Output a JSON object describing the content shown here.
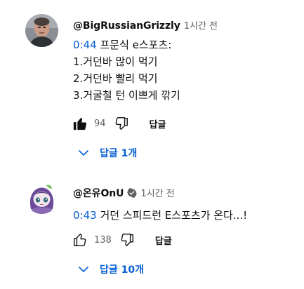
{
  "comments": [
    {
      "author": "@BigRussianGrizzly",
      "verified": false,
      "time": "1시간 전",
      "timestamp": "0:44",
      "lines": [
        "프문식 e스포츠:",
        "1.거던바 많이 먹기",
        "2.거던바 빨리 먹기",
        "3.거굴철 턴 이쁘게 깎기"
      ],
      "likes": "94",
      "reply_label": "답글",
      "replies_label": "답글 1개"
    },
    {
      "author": "@온유OnU",
      "verified": true,
      "time": "1시간 전",
      "timestamp": "0:43",
      "text": "거던 스피드런 E스포츠가 온다...!",
      "likes": "138",
      "reply_label": "답글",
      "replies_label": "답글 10개"
    }
  ],
  "colors": {
    "link": "#065fd4",
    "secondary_text": "#606060",
    "text": "#0f0f0f"
  },
  "icons": [
    "like-icon",
    "dislike-icon",
    "chevron-down-icon",
    "verified-check-icon"
  ]
}
